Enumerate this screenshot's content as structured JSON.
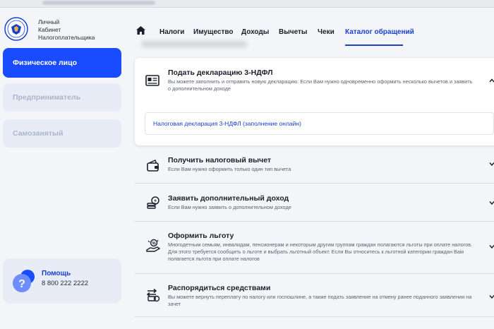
{
  "brand": {
    "line1": "Личный",
    "line2": "Кабинет",
    "line3": "Налогоплательщика"
  },
  "sidebar": {
    "items": [
      {
        "label": "Физическое лицо",
        "active": true
      },
      {
        "label": "Предприниматель",
        "active": false
      },
      {
        "label": "Самозанятый",
        "active": false
      }
    ],
    "help": {
      "title": "Помощь",
      "phone": "8 800 222 2222"
    }
  },
  "nav": {
    "items": [
      {
        "label": "Налоги"
      },
      {
        "label": "Имущество"
      },
      {
        "label": "Доходы"
      },
      {
        "label": "Вычеты"
      },
      {
        "label": "Чеки"
      },
      {
        "label": "Каталог обращений",
        "active": true
      }
    ]
  },
  "catalog": {
    "rows": [
      {
        "title": "Подать декларацию 3-НДФЛ",
        "subtitle_l1": "Вы можете заполнить и отправить новую декларацию. Если Вам нужно одновременно оформить несколько вычетов и заявить",
        "subtitle_l2": "о дополнительном доходе",
        "link": "Налоговая декларация 3-НДФЛ (заполнение онлайн)",
        "icon": "document-form-icon"
      },
      {
        "title": "Получить налоговый вычет",
        "subtitle_l1": "Если Вам нужно оформить только один тип вычета",
        "icon": "wallet-icon"
      },
      {
        "title": "Заявить дополнительный доход",
        "subtitle_l1": "Если Вам нужно заявить о дополнительном доходе",
        "icon": "coins-stack-icon"
      },
      {
        "title": "Оформить льготу",
        "subtitle_l1": "Многодетным семьям, инвалидам, пенсионерам и некоторым другим группам граждан полагаются льготы при оплате налогов.",
        "subtitle_l2": "Для этого требуется сообщить о льготе и выбрать льготный объект. Если Вы относитесь к льготной категории граждан Вам",
        "subtitle_l3": "полагается льгота при оплате налогов",
        "icon": "hand-percent-icon"
      },
      {
        "title": "Распорядиться средствами",
        "subtitle_l1": "Вы можете вернуть переплату по налогу или госпошлине, а также подать заявление на отмену ранее поданного заявления на",
        "subtitle_l2": "зачет",
        "icon": "money-transfer-icon"
      }
    ]
  },
  "colors": {
    "accent": "#1a4cff",
    "link": "#1a3fcf",
    "background": "#f4f5f8"
  }
}
